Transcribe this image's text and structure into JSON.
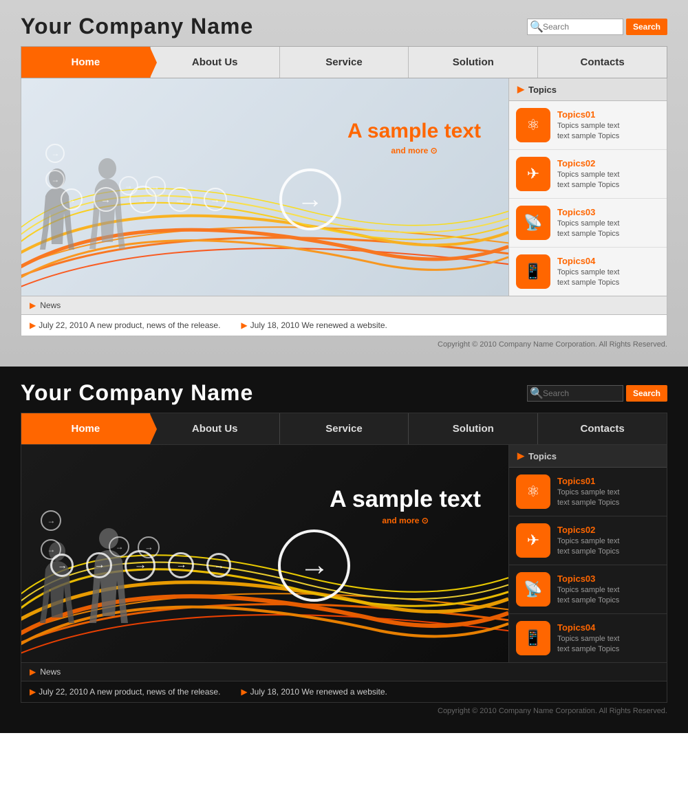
{
  "light": {
    "company_name": "Your Company Name",
    "search_placeholder": "Search",
    "search_button": "Search",
    "nav": {
      "home": "Home",
      "about": "About Us",
      "service": "Service",
      "solution": "Solution",
      "contacts": "Contacts"
    },
    "hero": {
      "sample_text": "A sample text",
      "and_more": "and more ⊙"
    },
    "topics_header": "Topics",
    "topics": [
      {
        "title": "Topics01",
        "desc": "Topics sample text\ntext sample Topics",
        "icon": "⚛"
      },
      {
        "title": "Topics02",
        "desc": "Topics sample text\ntext sample Topics",
        "icon": "✈"
      },
      {
        "title": "Topics03",
        "desc": "Topics sample text\ntext sample Topics",
        "icon": "📡"
      },
      {
        "title": "Topics04",
        "desc": "Topics sample text\ntext sample Topics",
        "icon": "📱"
      }
    ],
    "news_label": "News",
    "news_items": [
      "July 22, 2010  A new product, news of the release.",
      "July 18, 2010  We renewed a website."
    ],
    "copyright": "Copyright © 2010 Company Name Corporation. All Rights Reserved."
  },
  "dark": {
    "company_name": "Your Company Name",
    "search_placeholder": "Search",
    "search_button": "Search",
    "nav": {
      "home": "Home",
      "about": "About Us",
      "service": "Service",
      "solution": "Solution",
      "contacts": "Contacts"
    },
    "hero": {
      "sample_text": "A sample text",
      "and_more": "and more ⊙"
    },
    "topics_header": "Topics",
    "topics": [
      {
        "title": "Topics01",
        "desc": "Topics sample text\ntext sample Topics",
        "icon": "⚛"
      },
      {
        "title": "Topics02",
        "desc": "Topics sample text\ntext sample Topics",
        "icon": "✈"
      },
      {
        "title": "Topics03",
        "desc": "Topics sample text\ntext sample Topics",
        "icon": "📡"
      },
      {
        "title": "Topics04",
        "desc": "Topics sample text\ntext sample Topics",
        "icon": "📱"
      }
    ],
    "news_label": "News",
    "news_items": [
      "July 22, 2010  A new product, news of the release.",
      "July 18, 2010  We renewed a website."
    ],
    "copyright": "Copyright © 2010 Company Name Corporation. All Rights Reserved."
  }
}
